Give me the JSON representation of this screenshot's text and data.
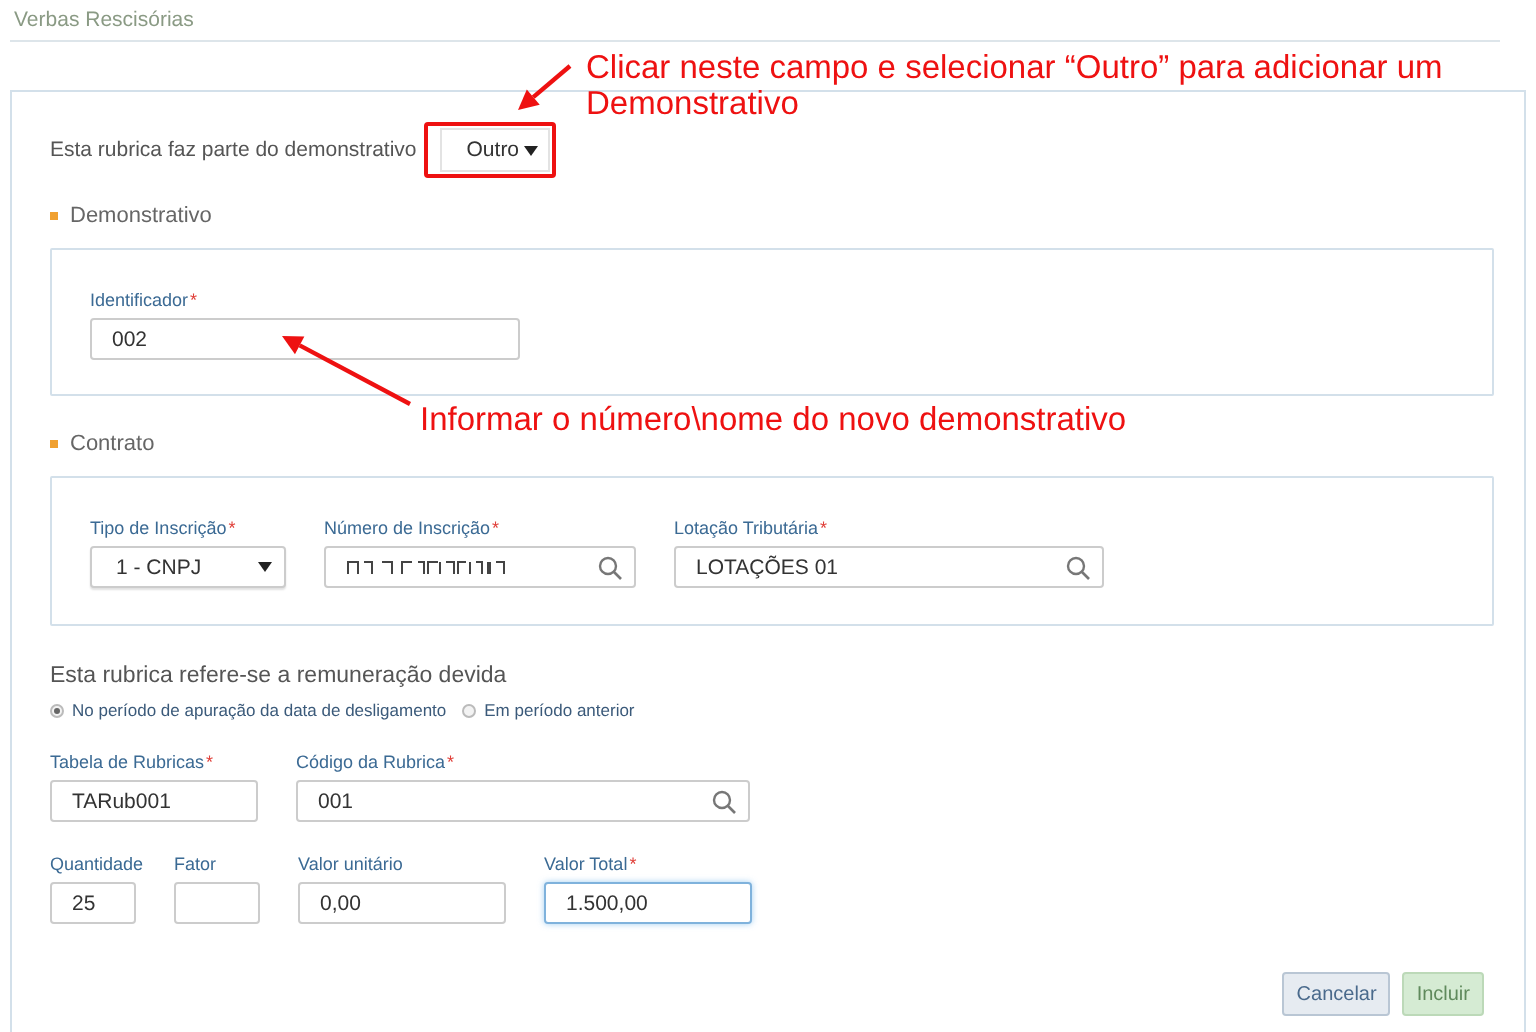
{
  "page_title": "Verbas Rescisórias",
  "demonstrativo_select": {
    "label": "Esta rubrica faz parte do demonstrativo",
    "value": "Outro"
  },
  "sections": [
    {
      "title": "Demonstrativo",
      "fields": [
        {
          "label": "Identificador",
          "required_mark": "*",
          "kind": "text",
          "value": "002"
        }
      ]
    },
    {
      "title": "Contrato",
      "fields": [
        {
          "label": "Tipo de Inscrição",
          "required_mark": "*",
          "kind": "select",
          "value": "1 - CNPJ"
        },
        {
          "label": "Número de Inscrição",
          "required_mark": "*",
          "kind": "search",
          "redacted": true
        },
        {
          "label": "Lotação Tributária",
          "required_mark": "*",
          "kind": "search",
          "value": "LOTAÇÕES 01"
        }
      ]
    }
  ],
  "remuneracao": {
    "question": "Esta rubrica refere-se a remuneração devida",
    "options": [
      {
        "label": "No período de apuração da data de desligamento",
        "selected": true
      },
      {
        "label": "Em período anterior",
        "selected": false
      }
    ]
  },
  "rubrica_fields": [
    {
      "label": "Tabela de Rubricas",
      "required_mark": "*",
      "kind": "text",
      "value": "TARub001"
    },
    {
      "label": "Código da Rubrica",
      "required_mark": "*",
      "kind": "search",
      "value": "001"
    }
  ],
  "value_fields": [
    {
      "label": "Quantidade",
      "kind": "text",
      "value": "25"
    },
    {
      "label": "Fator",
      "kind": "text"
    },
    {
      "label": "Valor unitário",
      "kind": "text",
      "value": "0,00"
    },
    {
      "label": "Valor Total",
      "required_mark": "*",
      "kind": "text",
      "value": "1.500,00",
      "focused": true
    }
  ],
  "buttons": [
    {
      "label": "Cancelar",
      "kind": "secondary"
    },
    {
      "label": "Incluir",
      "kind": "primary"
    }
  ],
  "annotations": [
    {
      "text": "Clicar neste campo e selecionar “Outro” para adicionar um Demonstrativo",
      "highlight": true
    },
    {
      "text": "Informar o número\\nome do novo demonstrativo"
    }
  ]
}
